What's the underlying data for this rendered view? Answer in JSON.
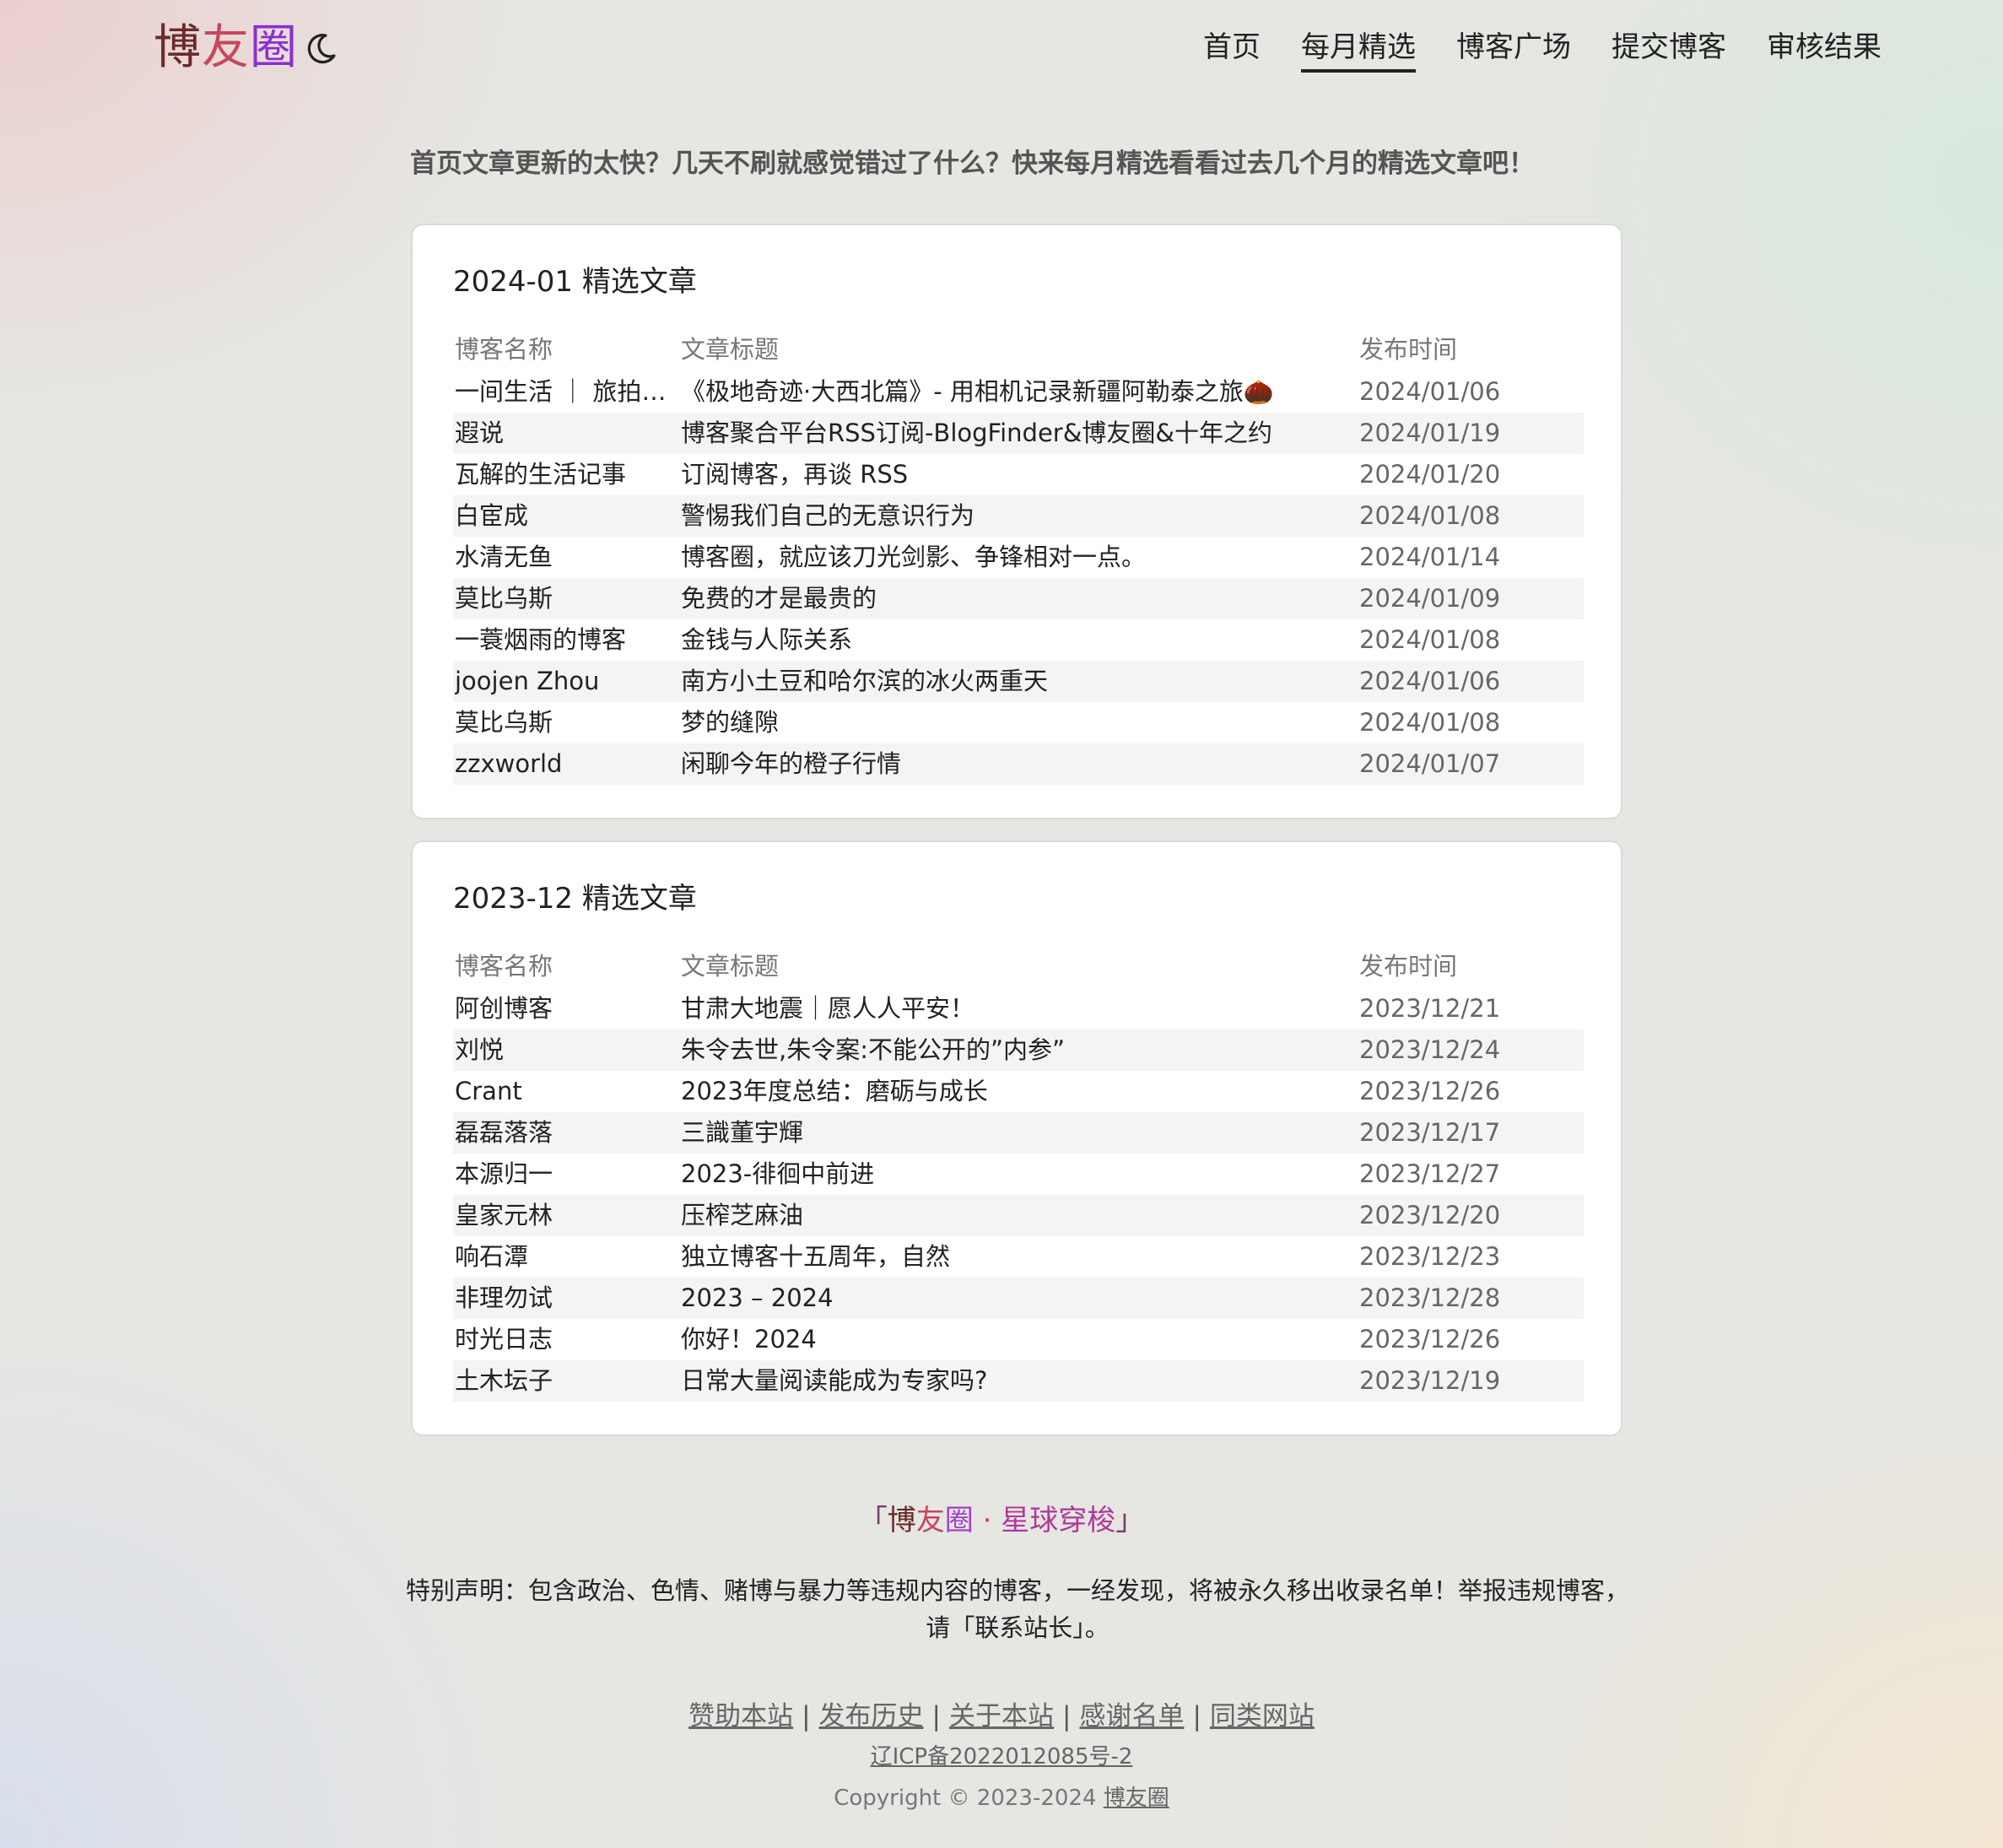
{
  "logo": {
    "part1": "博",
    "part2": "友",
    "part3": "圈"
  },
  "theme_toggle_icon": "moon-icon",
  "nav": [
    "首页",
    "每月精选",
    "博客广场",
    "提交博客",
    "审核结果"
  ],
  "intro": "首页文章更新的太快？几天不刷就感觉错过了什么？快来每月精选看看过去几个月的精选文章吧！",
  "columns": {
    "blog": "博客名称",
    "title": "文章标题",
    "date": "发布时间"
  },
  "months": [
    {
      "title": "2024-01 精选文章",
      "rows": [
        {
          "blog": "一间生活 ｜ 旅拍摄影",
          "title": "《极地奇迹·大西北篇》- 用相机记录新疆阿勒泰之旅🌰",
          "date": "2024/01/06"
        },
        {
          "blog": "遐说",
          "title": "博客聚合平台RSS订阅-BlogFinder&博友圈&十年之约",
          "date": "2024/01/19"
        },
        {
          "blog": "瓦解的生活记事",
          "title": "订阅博客，再谈 RSS",
          "date": "2024/01/20"
        },
        {
          "blog": "白宦成",
          "title": "警惕我们自己的无意识行为",
          "date": "2024/01/08"
        },
        {
          "blog": "水清无鱼",
          "title": "博客圈，就应该刀光剑影、争锋相对一点。",
          "date": "2024/01/14"
        },
        {
          "blog": "莫比乌斯",
          "title": "免费的才是最贵的",
          "date": "2024/01/09"
        },
        {
          "blog": "一蓑烟雨的博客",
          "title": "金钱与人际关系",
          "date": "2024/01/08"
        },
        {
          "blog": "joojen Zhou",
          "title": "南方小土豆和哈尔滨的冰火两重天",
          "date": "2024/01/06"
        },
        {
          "blog": "莫比乌斯",
          "title": "梦的缝隙",
          "date": "2024/01/08"
        },
        {
          "blog": "zzxworld",
          "title": "闲聊今年的橙子行情",
          "date": "2024/01/07"
        }
      ]
    },
    {
      "title": "2023-12 精选文章",
      "rows": [
        {
          "blog": "阿创博客",
          "title": "甘肃大地震｜愿人人平安！",
          "date": "2023/12/21"
        },
        {
          "blog": "刘悦",
          "title": "朱令去世,朱令案:不能公开的”内参”",
          "date": "2023/12/24"
        },
        {
          "blog": "Crant",
          "title": "2023年度总结：磨砺与成长",
          "date": "2023/12/26"
        },
        {
          "blog": "磊磊落落",
          "title": "三識董宇輝",
          "date": "2023/12/17"
        },
        {
          "blog": "本源归一",
          "title": "2023-徘徊中前进",
          "date": "2023/12/27"
        },
        {
          "blog": "皇家元林",
          "title": "压榨芝麻油",
          "date": "2023/12/20"
        },
        {
          "blog": "响石潭",
          "title": "独立博客十五周年，自然",
          "date": "2023/12/23"
        },
        {
          "blog": "非理勿试",
          "title": "2023 – 2024",
          "date": "2023/12/28"
        },
        {
          "blog": "时光日志",
          "title": "你好！2024",
          "date": "2023/12/26"
        },
        {
          "blog": "土木坛子",
          "title": "日常大量阅读能成为专家吗?",
          "date": "2023/12/19"
        }
      ]
    }
  ],
  "slogan": {
    "open": "「",
    "p1": "博",
    "p2": "友",
    "p3": "圈",
    "dot": " · ",
    "p4": "星球穿梭",
    "close": "」"
  },
  "notice": "特别声明：包含政治、色情、赌博与暴力等违规内容的博客，一经发现，将被永久移出收录名单！举报违规博客，请「联系站长」。",
  "footer_links": [
    "赞助本站",
    "发布历史",
    "关于本站",
    "感谢名单",
    "同类网站"
  ],
  "footer_sep": "|",
  "icp": "辽ICP备2022012085号-2",
  "copyright": "Copyright © 2023-2024",
  "copyright_link": "博友圈"
}
